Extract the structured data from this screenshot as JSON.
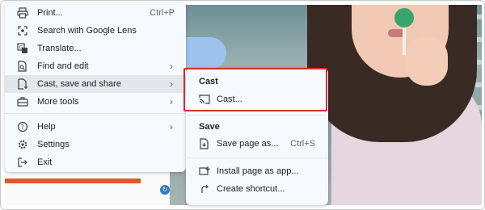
{
  "menu": {
    "items": [
      {
        "label": "Print...",
        "icon": "print-icon",
        "shortcut": "Ctrl+P"
      },
      {
        "label": "Search with Google Lens",
        "icon": "lens-icon"
      },
      {
        "label": "Translate...",
        "icon": "translate-icon"
      },
      {
        "label": "Find and edit",
        "icon": "find-edit-icon",
        "arrow": "›"
      },
      {
        "label": "Cast, save and share",
        "icon": "cast-save-share-icon",
        "arrow": "›"
      },
      {
        "label": "More tools",
        "icon": "more-tools-icon",
        "arrow": "›"
      },
      {
        "label": "Help",
        "icon": "help-icon",
        "arrow": "›"
      },
      {
        "label": "Settings",
        "icon": "settings-icon"
      },
      {
        "label": "Exit",
        "icon": "exit-icon"
      }
    ]
  },
  "submenu": {
    "cast_header": "Cast",
    "cast_item": "Cast...",
    "save_header": "Save",
    "save_item": "Save page as...",
    "save_shortcut": "Ctrl+S",
    "install_item": "Install page as app...",
    "shortcut_item": "Create shortcut..."
  },
  "colors": {
    "highlight_box": "#d32f2f",
    "menu_bg": "#f6fafe"
  }
}
